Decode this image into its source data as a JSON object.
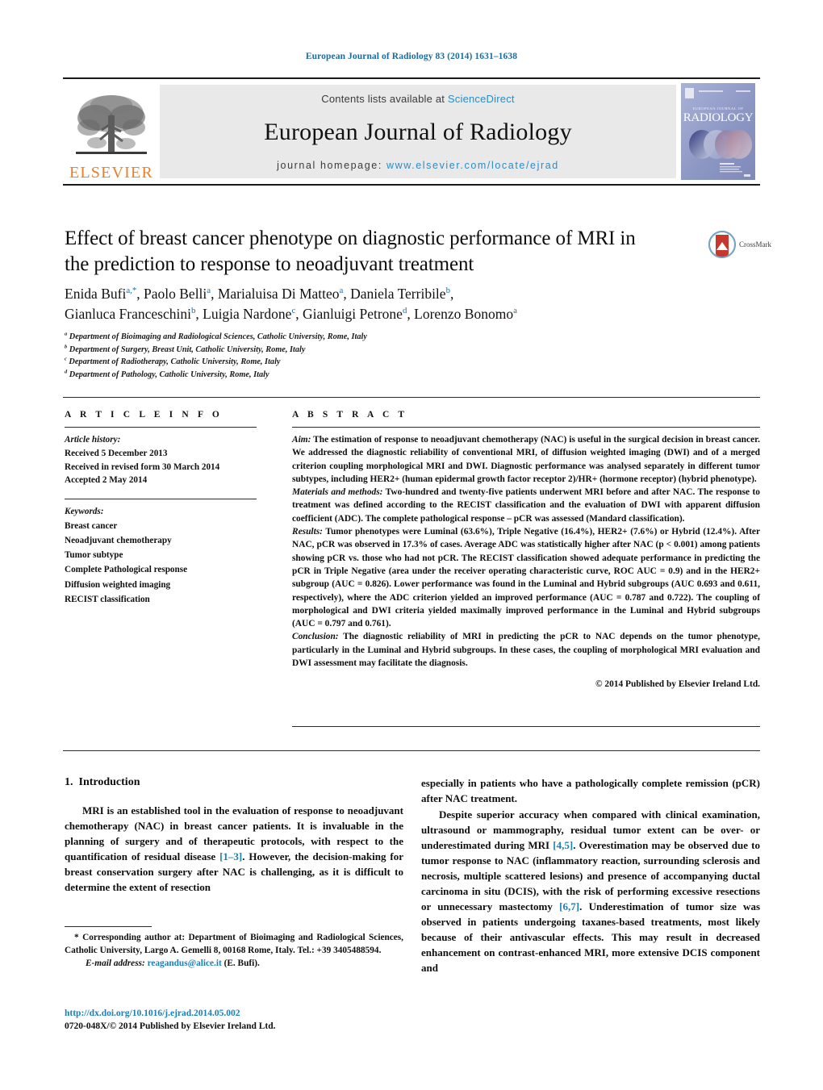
{
  "running_head": "European Journal of Radiology 83 (2014) 1631–1638",
  "masthead": {
    "publisher_name": "ELSEVIER",
    "contents_prefix": "Contents lists available at",
    "contents_link": "ScienceDirect",
    "journal_title": "European Journal of Radiology",
    "homepage_prefix": "journal homepage:",
    "homepage_url": "www.elsevier.com/locate/ejrad",
    "cover_title": "RADIOLOGY",
    "cover_overline": "EUROPEAN JOURNAL OF"
  },
  "crossmark": {
    "label": "CrossMark"
  },
  "article": {
    "title_line1": "Effect of breast cancer phenotype on diagnostic performance of MRI in",
    "title_line2": "the prediction to response to neoadjuvant treatment",
    "authors_line1": "Enida Bufi",
    "authors_line1_sup": "a,*",
    "authors_line1_b": ", Paolo Belli",
    "authors_line1_b_sup": "a",
    "authors_line1_c": ", Marialuisa Di Matteo",
    "authors_line1_c_sup": "a",
    "authors_line1_d": ", Daniela Terribile",
    "authors_line1_d_sup": "b",
    "authors_line1_end": ",",
    "authors_line2_a": "Gianluca Franceschini",
    "authors_line2_a_sup": "b",
    "authors_line2_b": ", Luigia Nardone",
    "authors_line2_b_sup": "c",
    "authors_line2_c": ", Gianluigi Petrone",
    "authors_line2_c_sup": "d",
    "authors_line2_d": ", Lorenzo Bonomo",
    "authors_line2_d_sup": "a",
    "affiliations": [
      {
        "marker": "a",
        "text": "Department of Bioimaging and Radiological Sciences, Catholic University, Rome, Italy"
      },
      {
        "marker": "b",
        "text": "Department of Surgery, Breast Unit, Catholic University, Rome, Italy"
      },
      {
        "marker": "c",
        "text": "Department of Radiotherapy, Catholic University, Rome, Italy"
      },
      {
        "marker": "d",
        "text": "Department of Pathology, Catholic University, Rome, Italy"
      }
    ]
  },
  "article_info": {
    "heading": "A R T I C L E    I N F O",
    "history_label": "Article history:",
    "history": [
      "Received 5 December 2013",
      "Received in revised form 30 March 2014",
      "Accepted 2 May 2014"
    ],
    "keywords_label": "Keywords:",
    "keywords": [
      "Breast cancer",
      "Neoadjuvant chemotherapy",
      "Tumor subtype",
      "Complete Pathological response",
      "Diffusion weighted imaging",
      "RECIST classification"
    ]
  },
  "abstract": {
    "heading": "A B S T R A C T",
    "aim_label": "Aim:",
    "aim_text": " The estimation of response to neoadjuvant chemotherapy (NAC) is useful in the surgical decision in breast cancer. We addressed the diagnostic reliability of conventional MRI, of diffusion weighted imaging (DWI) and of a merged criterion coupling morphological MRI and DWI. Diagnostic performance was analysed separately in different tumor subtypes, including HER2+ (human epidermal growth factor receptor 2)/HR+ (hormone receptor) (hybrid phenotype).",
    "methods_label": "Materials and methods:",
    "methods_text": " Two-hundred and twenty-five patients underwent MRI before and after NAC. The response to treatment was defined according to the RECIST classification and the evaluation of DWI with apparent diffusion coefficient (ADC). The complete pathological response – pCR was assessed (Mandard classification).",
    "results_label": "Results:",
    "results_text": " Tumor phenotypes were Luminal (63.6%), Triple Negative (16.4%), HER2+ (7.6%) or Hybrid (12.4%). After NAC, pCR was observed in 17.3% of cases. Average ADC was statistically higher after NAC (p < 0.001) among patients showing pCR vs. those who had not pCR. The RECIST classification showed adequate performance in predicting the pCR in Triple Negative (area under the receiver operating characteristic curve, ROC AUC = 0.9) and in the HER2+ subgroup (AUC = 0.826). Lower performance was found in the Luminal and Hybrid subgroups (AUC 0.693 and 0.611, respectively), where the ADC criterion yielded an improved performance (AUC = 0.787 and 0.722). The coupling of morphological and DWI criteria yielded maximally improved performance in the Luminal and Hybrid subgroups (AUC = 0.797 and 0.761).",
    "conclusion_label": "Conclusion:",
    "conclusion_text": " The diagnostic reliability of MRI in predicting the pCR to NAC depends on the tumor phenotype, particularly in the Luminal and Hybrid subgroups. In these cases, the coupling of morphological MRI evaluation and DWI assessment may facilitate the diagnosis.",
    "copyright": "© 2014 Published by Elsevier Ireland Ltd."
  },
  "body": {
    "section_number": "1.",
    "section_title": "Introduction",
    "left_paragraphs": [
      {
        "pre": "MRI is an established tool in the evaluation of response to neoadjuvant chemotherapy (NAC) in breast cancer patients. It is invaluable in the planning of surgery and of therapeutic protocols, with respect to the quantification of residual disease ",
        "ref": "[1–3]",
        "post": ". However, the decision-making for breast conservation surgery after NAC is challenging, as it is difficult to determine the extent of resection"
      }
    ],
    "right_paragraphs": [
      {
        "pre": "especially in patients who have a pathologically complete remission (pCR) after NAC treatment.",
        "ref": "",
        "post": ""
      },
      {
        "pre": "Despite superior accuracy when compared with clinical examination, ultrasound or mammography, residual tumor extent can be over- or underestimated during MRI ",
        "ref": "[4,5]",
        "post": ". Overestimation may be observed due to tumor response to NAC (inflammatory reaction, surrounding sclerosis and necrosis, multiple scattered lesions) and presence of accompanying ductal carcinoma in situ (DCIS), with the risk of performing excessive resections or unnecessary mastectomy "
      },
      {
        "pre": "",
        "ref": "[6,7]",
        "post": ". Underestimation of tumor size was observed in patients undergoing taxanes-based treatments, most likely because of their antivascular effects. This may result in decreased enhancement on contrast-enhanced MRI, more extensive DCIS component and"
      }
    ]
  },
  "footnotes": {
    "corresponding_marker": "*",
    "corresponding_text": " Corresponding author at: Department of Bioimaging and Radiological Sciences, Catholic University, Largo A. Gemelli 8, 00168 Rome, Italy. Tel.: +39 3405488594.",
    "email_label": "E-mail address:",
    "email_value": "reagandus@alice.it",
    "email_suffix": " (E. Bufi).",
    "doi_url": "http://dx.doi.org/10.1016/j.ejrad.2014.05.002",
    "issn_line": "0720-048X/© 2014 Published by Elsevier Ireland Ltd."
  },
  "colors": {
    "link": "#1b7fb8",
    "header_blue": "#1b6ba3",
    "elsevier_orange": "#ef7d22",
    "sciencedirect": "#2e8bc4",
    "crossmark_red": "#c8372d"
  }
}
